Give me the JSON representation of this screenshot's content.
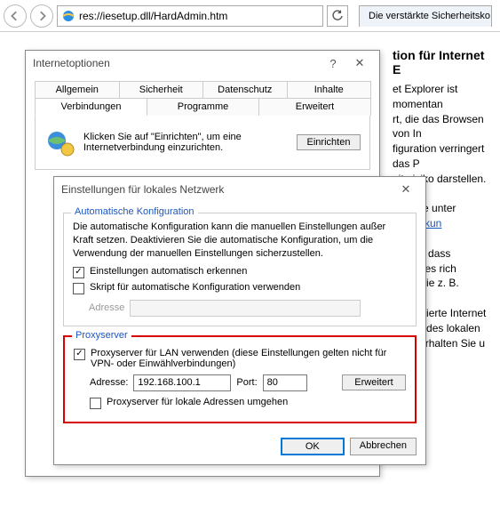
{
  "browser": {
    "url_text": "res://iesetup.dll/HardAdmin.htm",
    "tab_label": "Die verstärkte Sicherheitsko...",
    "page_title": "tion für Internet E",
    "page_body_line1": "et Explorer ist momentan",
    "page_body_line2": "rt, die das Browsen von In",
    "page_body_line3": "figuration verringert das P",
    "page_body_line4": "eitsrisiko darstellen. Eine",
    "page_body_line5": "den Sie unter",
    "link_auswirk": "Auswirkun",
    "page_body_line6": "indern, dass Websites rich",
    "page_body_line7": "igen, wie z. B. UNC-F",
    "page_body_line8": "deaktivierte Internet",
    "page_body_line9": "r Zone des lokalen",
    "page_body_line10": "onen erhalten Sie u"
  },
  "internet_options": {
    "title": "Internetoptionen",
    "tabs": {
      "allgemein": "Allgemein",
      "sicherheit": "Sicherheit",
      "datenschutz": "Datenschutz",
      "inhalte": "Inhalte",
      "verbindungen": "Verbindungen",
      "programme": "Programme",
      "erweitert": "Erweitert"
    },
    "conn_text": "Klicken Sie auf \"Einrichten\", um eine Internetverbindung einzurichten.",
    "btn_einrichten": "Einrichten"
  },
  "lan": {
    "title": "Einstellungen für lokales Netzwerk",
    "auto_legend": "Automatische Konfiguration",
    "auto_desc": "Die automatische Konfiguration kann die manuellen Einstellungen außer Kraft setzen. Deaktivieren Sie die automatische Konfiguration, um die Verwendung der manuellen Einstellungen sicherzustellen.",
    "chk_auto_detect": "Einstellungen automatisch erkennen",
    "chk_script": "Skript für automatische Konfiguration verwenden",
    "lbl_adresse": "Adresse",
    "script_addr_value": "",
    "proxy_legend": "Proxyserver",
    "chk_proxy": "Proxyserver für LAN verwenden (diese Einstellungen gelten nicht für VPN- oder Einwählverbindungen)",
    "lbl_proxy_addr": "Adresse:",
    "proxy_addr_value": "192.168.100.1",
    "lbl_port": "Port:",
    "port_value": "80",
    "btn_erweitert": "Erweitert",
    "chk_bypass": "Proxyserver für lokale Adressen umgehen",
    "btn_ok": "OK",
    "btn_cancel": "Abbrechen"
  }
}
